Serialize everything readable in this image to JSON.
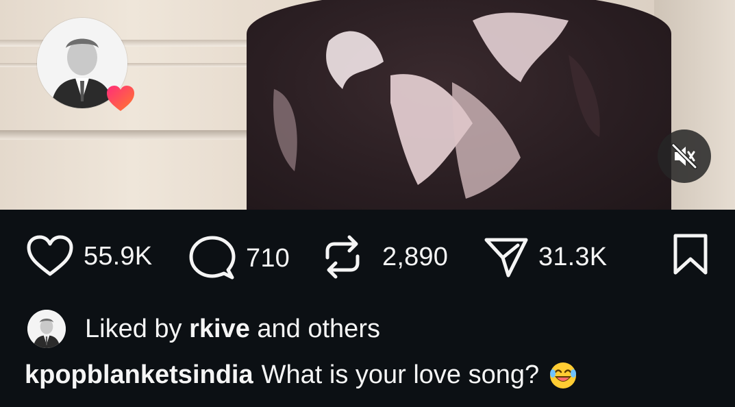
{
  "post": {
    "avatar_icon": "profile-photo",
    "badge_icon": "heart-icon",
    "mute_icon": "speaker-muted-icon"
  },
  "actions": {
    "likes": "55.9K",
    "comments": "710",
    "reposts": "2,890",
    "shares": "31.3K"
  },
  "liked_by": {
    "prefix": "Liked by ",
    "user": "rkive",
    "suffix": " and others"
  },
  "caption": {
    "username": "kpopblanketsindia",
    "text": "What is your love song?",
    "emoji": "😂"
  },
  "colors": {
    "background": "#0c1014",
    "text": "#f5f5f5",
    "badge_gradient_start": "#ff2d7a",
    "badge_gradient_end": "#ff7a2d"
  }
}
